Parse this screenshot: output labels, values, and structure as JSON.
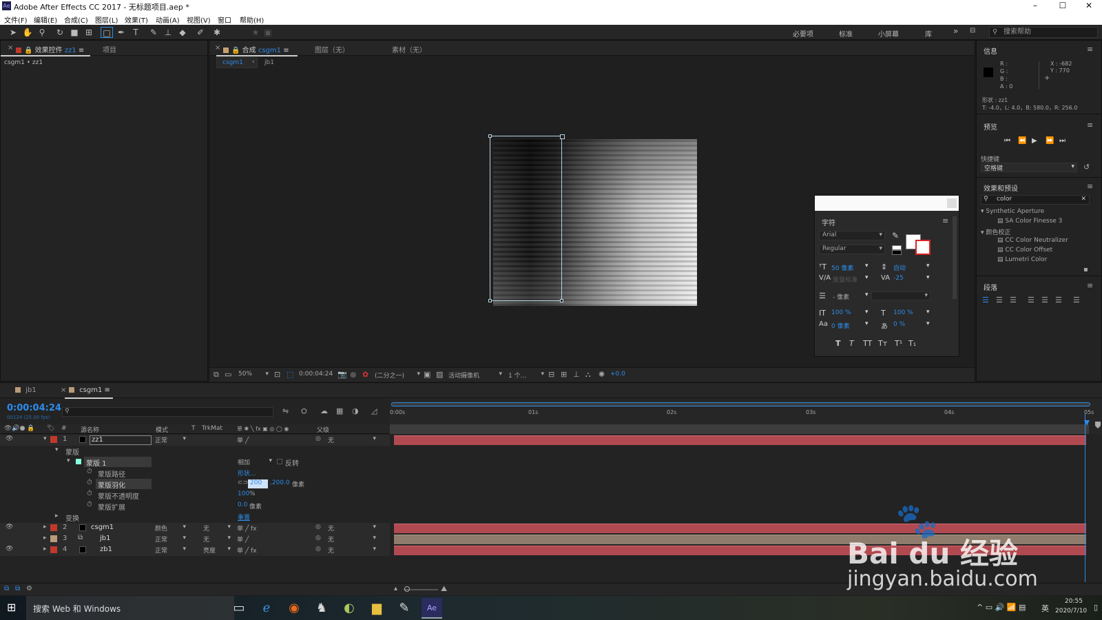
{
  "app": {
    "title": "Adobe After Effects CC 2017 - 无标题项目.aep *",
    "logo": "Ae"
  },
  "window_controls": [
    "–",
    "☐",
    "✕"
  ],
  "menu": [
    "文件(F)",
    "编辑(E)",
    "合成(C)",
    "图层(L)",
    "效果(T)",
    "动画(A)",
    "视图(V)",
    "窗口",
    "帮助(H)"
  ],
  "workspaces": [
    "必要项",
    "标准",
    "小屏幕",
    "库"
  ],
  "search_help": "搜索帮助",
  "left_panel": {
    "tab_effects": "效果控件",
    "tab_effects_target": "zz1",
    "tab_project": "项目",
    "breadcrumb": "csgm1 • zz1"
  },
  "comp_panel": {
    "tab_comp_prefix": "合成",
    "tab_comp_name": "csgm1",
    "tab_layer": "图层（无）",
    "tab_footage": "素材（无）",
    "sub_tab_active": "csgm1",
    "sub_tab_other": "jb1",
    "zoom": "50%",
    "timecode": "0:00:04:24",
    "resolution": "(二分之一)",
    "camera": "活动摄像机",
    "views": "1 个...",
    "exposure": "+0.0"
  },
  "info_panel": {
    "title": "信息",
    "r": "R :",
    "g": "G :",
    "b": "B :",
    "a": "A : 0",
    "x": "X : -682",
    "y": "Y : 770",
    "shape_label": "形状 : zz1",
    "shape_bounds": "T: -4.0，L: 4.0，B: 580.0，R: 256.0"
  },
  "preview_panel": {
    "title": "预览",
    "shortcut_label": "快捷键",
    "shortcut_value": "空格键"
  },
  "effects_panel": {
    "title": "效果和预设",
    "search_value": "color",
    "groups": [
      {
        "name": "Synthetic Aperture",
        "items": [
          "SA Color Finesse 3"
        ]
      },
      {
        "name": "颜色校正",
        "items": [
          "CC Color Neutralizer",
          "CC Color Offset",
          "Lumetri Color"
        ]
      }
    ]
  },
  "paragraph_panel": {
    "title": "段落"
  },
  "character_panel": {
    "title": "字符",
    "font": "Arial",
    "style": "Regular",
    "size": "50 像素",
    "leading": "自动",
    "kerning": "度量标准",
    "tracking": "-25",
    "stroke": "- 像素",
    "vscale": "100 %",
    "hscale": "100 %",
    "baseline": "0 像素",
    "tsume": "0 %",
    "styles": [
      "T",
      "T",
      "TT",
      "Tт",
      "T¹",
      "T₁"
    ]
  },
  "timeline": {
    "tab_jb1": "jb1",
    "tab_csgm1": "csgm1",
    "timecode": "0:00:04:24",
    "fps": "00124 (25.00 fps)",
    "ruler": [
      "0:00s",
      "01s",
      "02s",
      "03s",
      "04s",
      "05s"
    ],
    "headers": {
      "num": "#",
      "source": "源名称",
      "mode": "模式",
      "t": "T",
      "trkmat": "TrkMat",
      "switches": "单 ✱ ╲ fx ▣ ◎ ◯ ◉",
      "parent": "父级"
    },
    "layers": [
      {
        "num": "1",
        "name": "zz1",
        "mode": "正常",
        "trkmat": "",
        "parent": "无",
        "color": "#c0392b"
      },
      {
        "num": "2",
        "name": "csgm1",
        "mode": "颜色",
        "trkmat": "无",
        "parent": "无",
        "color": "#c0392b"
      },
      {
        "num": "3",
        "name": "jb1",
        "mode": "正常",
        "trkmat": "无",
        "parent": "无",
        "color": "#b99a7a"
      },
      {
        "num": "4",
        "name": "zb1",
        "mode": "正常",
        "trkmat": "亮度",
        "parent": "无",
        "color": "#c0392b"
      }
    ],
    "masks_group": "蒙版",
    "mask1": "蒙版 1",
    "mask_mode": "相加",
    "mask_invert": "反转",
    "mask_path": "蒙版路径",
    "mask_path_value": "形状...",
    "mask_feather": "蒙版羽化",
    "mask_feather_value1": "200",
    "mask_feather_value2": ",200.0",
    "mask_feather_unit": "像素",
    "mask_opacity": "蒙版不透明度",
    "mask_opacity_value": "100",
    "mask_opacity_unit": "%",
    "mask_expansion": "蒙版扩展",
    "mask_expansion_value": "0.0",
    "mask_expansion_unit": "像素",
    "transform": "变换",
    "transform_reset": "重置"
  },
  "taskbar": {
    "search": "搜索 Web 和 Windows",
    "time": "20:55",
    "date": "2020/7/10",
    "lang": "英"
  },
  "watermark": {
    "brand": "Bai du 经验",
    "url": "jingyan.baidu.com"
  }
}
